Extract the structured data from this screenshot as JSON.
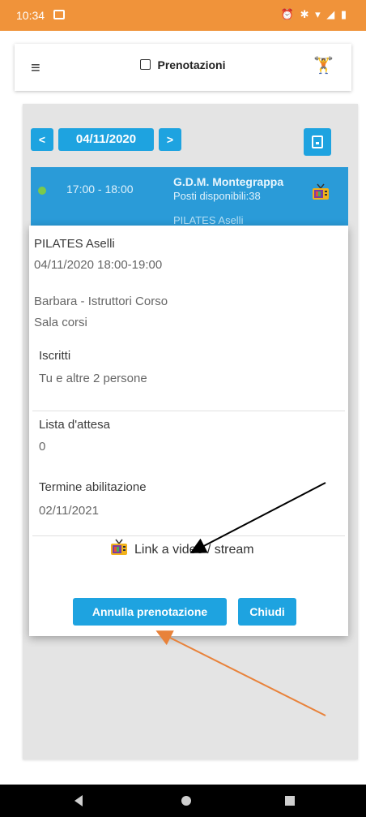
{
  "status_bar": {
    "time": "10:34",
    "icons": "⏰ ✱ ▾ ◢ ▮"
  },
  "app_bar": {
    "menu_icon": "≡",
    "title": "Prenotazioni",
    "gym_icon": "🏋"
  },
  "date_nav": {
    "prev": "<",
    "date": "04/11/2020",
    "next": ">"
  },
  "slot": {
    "time": "17:00 - 18:00",
    "name": "G.D.M. Montegrappa",
    "posti": "Posti disponibili:38",
    "next_partial": "PILATES Aselli"
  },
  "modal": {
    "title": "PILATES Aselli",
    "datetime": "04/11/2020 18:00-19:00",
    "instructor": "Barbara - Istruttori Corso",
    "room": "Sala corsi",
    "iscritti_label": "Iscritti",
    "iscritti_value": "Tu e altre 2 persone",
    "attesa_label": "Lista d'attesa",
    "attesa_value": "0",
    "termine_label": "Termine abilitazione",
    "termine_value": "02/11/2021",
    "video_link": "Link a video / stream",
    "annulla": "Annulla prenotazione",
    "chiudi": "Chiudi"
  },
  "colors": {
    "status_bar": "#f0933a",
    "accent": "#1ea3e0",
    "slot_row": "#2a9bd8",
    "annotation_arrow_black": "#000000",
    "annotation_arrow_orange": "#e8823a"
  }
}
